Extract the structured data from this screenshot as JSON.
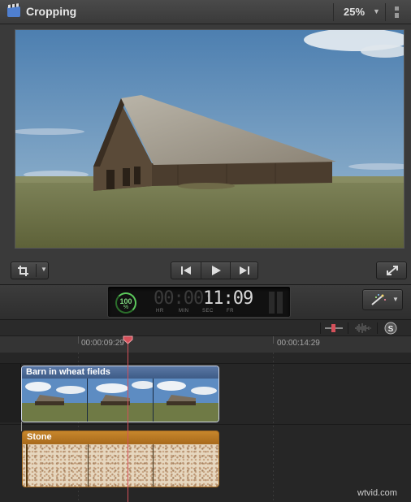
{
  "viewer": {
    "title": "Cropping",
    "zoom": "25%"
  },
  "dashboard": {
    "gauge_value": "100",
    "gauge_unit": "%",
    "timecode_dim": "00:00:",
    "timecode_lit": "11:09",
    "timecode_labels": [
      "HR",
      "MIN",
      "SEC",
      "FR"
    ]
  },
  "timeline": {
    "ruler_labels": [
      "00:00:09:29",
      "00:00:14:29"
    ],
    "clips": {
      "video": {
        "name": "Barn in wheat fields"
      },
      "audio": {
        "name": "Stone"
      }
    }
  },
  "colors": {
    "playhead": "#d5505a",
    "video_clip": "#3e5b86",
    "audio_clip": "#a86a1c",
    "gauge": "#5cc95c"
  },
  "icons": [
    "clapper-icon",
    "view-options-icon",
    "crop-icon",
    "previous-frame-icon",
    "play-icon",
    "next-frame-icon",
    "fullscreen-icon",
    "magic-wand-icon",
    "zoom-slider-icon",
    "audio-waveform-icon",
    "snapping-icon"
  ],
  "watermark": "wtvid.com"
}
